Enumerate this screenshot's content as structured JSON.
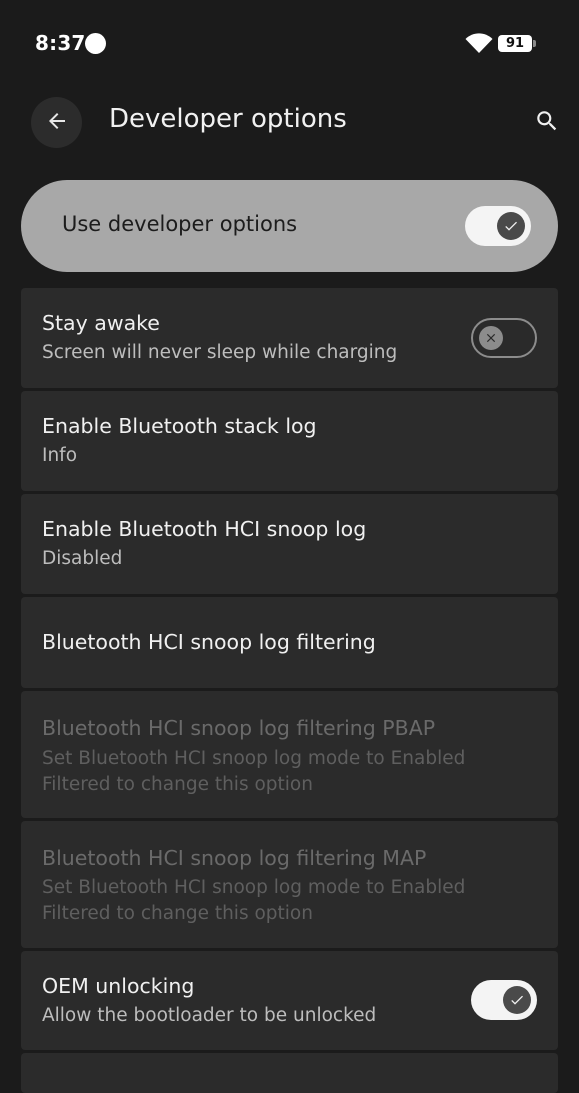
{
  "status_bar": {
    "time": "8:37",
    "battery_level": "91",
    "icons": [
      "notification-dot-icon",
      "wifi-icon",
      "battery-icon"
    ]
  },
  "header": {
    "title": "Developer options",
    "back_icon": "arrow-back-icon",
    "search_icon": "search-icon"
  },
  "master_switch": {
    "label": "Use developer options",
    "checked": true
  },
  "settings": [
    {
      "title": "Stay awake",
      "summary": "Screen will never sleep while charging",
      "switch": true,
      "checked": false,
      "enabled": true
    },
    {
      "title": "Enable Bluetooth stack log",
      "summary": "Info",
      "switch": false,
      "enabled": true
    },
    {
      "title": "Enable Bluetooth HCI snoop log",
      "summary": "Disabled",
      "switch": false,
      "enabled": true
    },
    {
      "title": "Bluetooth HCI snoop log filtering",
      "summary": "",
      "switch": false,
      "enabled": true
    },
    {
      "title": "Bluetooth HCI snoop log filtering PBAP",
      "summary_line1": "Set Bluetooth HCI snoop log mode to Enabled",
      "summary_line2": "Filtered to change this option",
      "switch": false,
      "enabled": false
    },
    {
      "title": "Bluetooth HCI snoop log filtering MAP",
      "summary_line1": "Set Bluetooth HCI snoop log mode to Enabled",
      "summary_line2": "Filtered to change this option",
      "switch": false,
      "enabled": false
    },
    {
      "title": "OEM unlocking",
      "summary": "Allow the bootloader to be unlocked",
      "switch": true,
      "checked": true,
      "enabled": true
    }
  ],
  "colors": {
    "background": "#1b1b1b",
    "row_background": "#2b2b2b",
    "master_background": "#a8a8a8",
    "text_primary": "#f0f0f0",
    "text_secondary": "#bdbdbd",
    "text_disabled": "#6a6a6a"
  }
}
